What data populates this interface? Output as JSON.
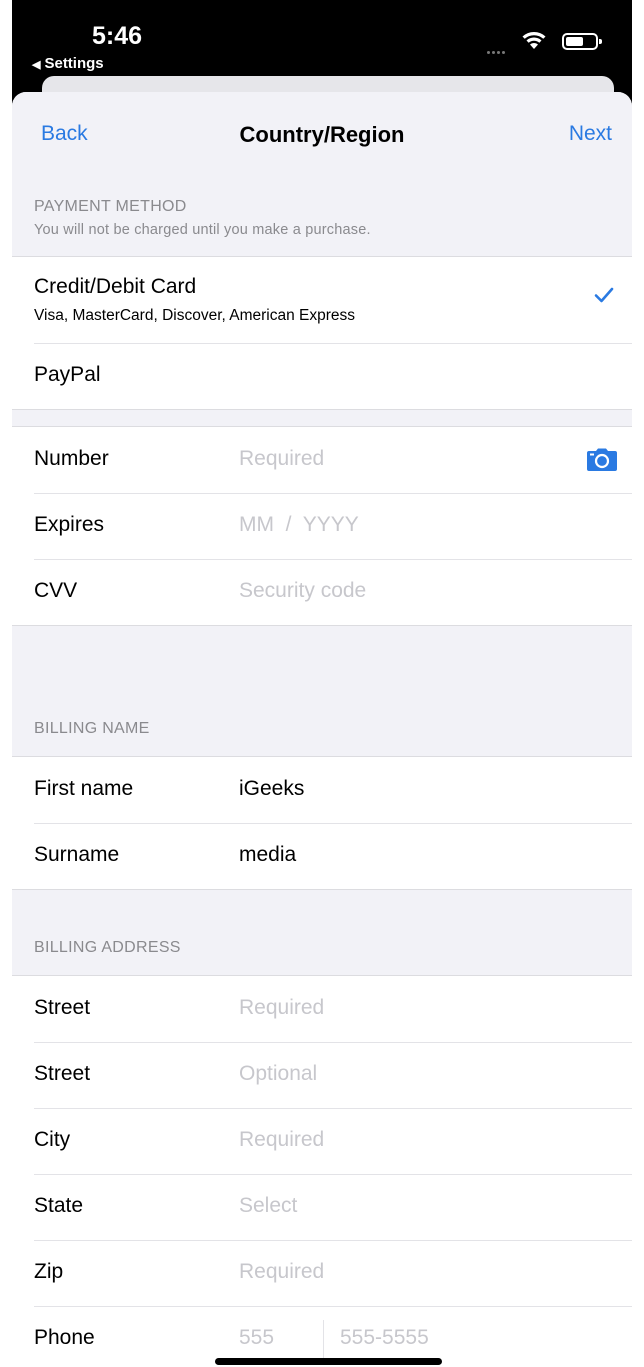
{
  "status_bar": {
    "time": "5:46",
    "back_app": "Settings",
    "icons": [
      "cellular-signal-icon",
      "wifi-icon",
      "battery-icon"
    ]
  },
  "nav": {
    "back": "Back",
    "title": "Country/Region",
    "next": "Next"
  },
  "payment_section": {
    "header": "PAYMENT METHOD",
    "subheader": "You will not be charged until you make a purchase.",
    "options": [
      {
        "label": "Credit/Debit Card",
        "detail": "Visa, MasterCard, Discover, American Express",
        "selected": true
      },
      {
        "label": "PayPal",
        "selected": false
      }
    ]
  },
  "card_fields": {
    "number": {
      "label": "Number",
      "placeholder": "Required"
    },
    "expires": {
      "label": "Expires",
      "placeholder": "MM  /  YYYY"
    },
    "cvv": {
      "label": "CVV",
      "placeholder": "Security code"
    }
  },
  "billing_name": {
    "header": "BILLING NAME",
    "first_name": {
      "label": "First name",
      "value": "iGeeks"
    },
    "surname": {
      "label": "Surname",
      "value": "media"
    }
  },
  "billing_address": {
    "header": "BILLING ADDRESS",
    "street1": {
      "label": "Street",
      "placeholder": "Required"
    },
    "street2": {
      "label": "Street",
      "placeholder": "Optional"
    },
    "city": {
      "label": "City",
      "placeholder": "Required"
    },
    "state": {
      "label": "State",
      "placeholder": "Select"
    },
    "zip": {
      "label": "Zip",
      "placeholder": "Required"
    },
    "phone": {
      "label": "Phone",
      "area_placeholder": "555",
      "number_placeholder": "555-5555"
    }
  },
  "colors": {
    "accent": "#2a7ae2",
    "placeholder": "#c7c7cc",
    "section_header": "#8a8a8e",
    "background": "#f2f2f7"
  }
}
